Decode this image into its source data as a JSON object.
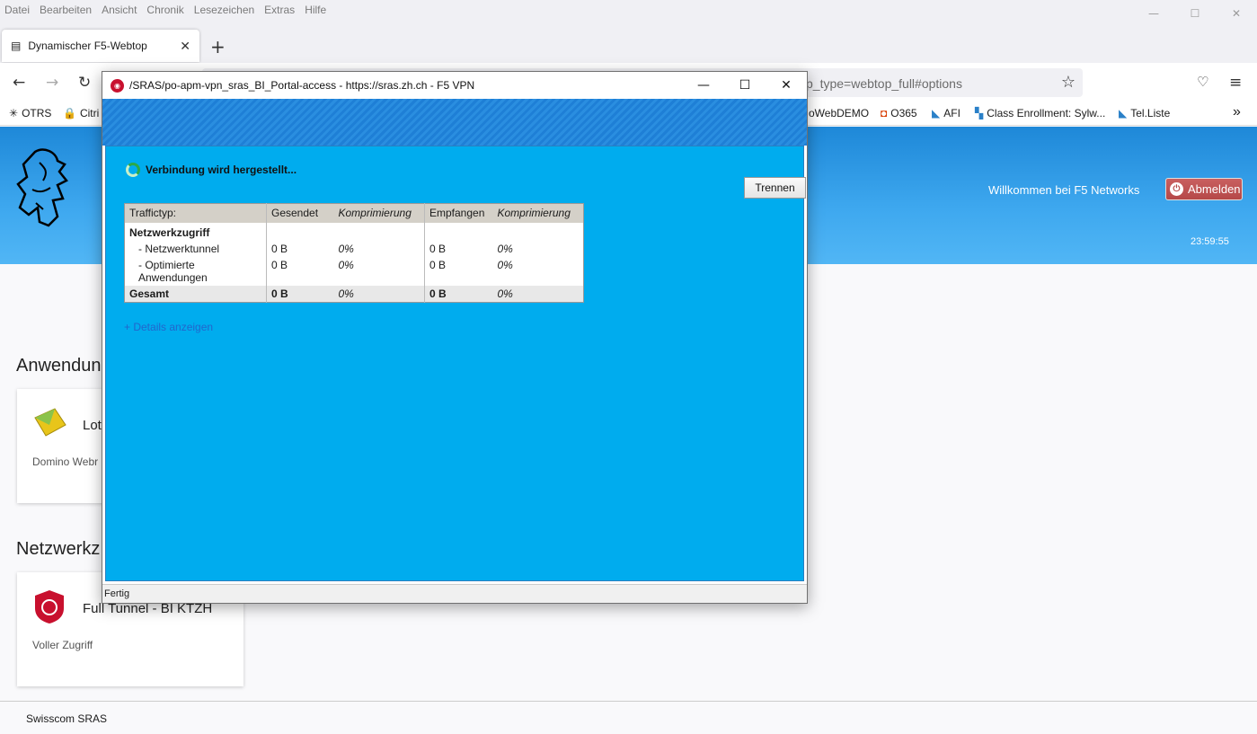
{
  "browser": {
    "menu": [
      "Datei",
      "Bearbeiten",
      "Ansicht",
      "Chronik",
      "Lesezeichen",
      "Extras",
      "Hilfe"
    ],
    "tab_title": "Dynamischer F5-Webtop",
    "url_visible": "p_type=webtop_full#options",
    "bookmarks": [
      "OTRS",
      "Citri",
      "oWebDEMO",
      "O365",
      "AFI",
      "Class Enrollment: Sylw...",
      "Tel.Liste"
    ]
  },
  "webtop": {
    "welcome": "Willkommen bei F5 Networks",
    "logout": "Abmelden",
    "clock": "23:59:55",
    "section_apps": "Anwendun",
    "app_card": {
      "title": "Lot",
      "subtitle": "Domino Webr"
    },
    "section_network": "Netzwerkz",
    "network_card": {
      "title": "Full Tunnel - BI KTZH",
      "subtitle": "Voller Zugriff"
    },
    "footer": "Swisscom SRAS"
  },
  "popup": {
    "title": "/SRAS/po-apm-vpn_sras_BI_Portal-access - https://sras.zh.ch - F5 VPN",
    "status": "Verbindung wird hergestellt...",
    "disconnect": "Trennen",
    "headers": [
      "Traffictyp:",
      "Gesendet",
      "Komprimierung",
      "Empfangen",
      "Komprimierung"
    ],
    "group": "Netzwerkzugriff",
    "rows": [
      {
        "label": "- Netzwerktunnel",
        "sent": "0 B",
        "sent_comp": "0%",
        "recv": "0 B",
        "recv_comp": "0%"
      },
      {
        "label": "- Optimierte",
        "label2": "Anwendungen",
        "sent": "0 B",
        "sent_comp": "0%",
        "recv": "0 B",
        "recv_comp": "0%"
      }
    ],
    "total": {
      "label": "Gesamt",
      "sent": "0 B",
      "sent_comp": "0%",
      "recv": "0 B",
      "recv_comp": "0%"
    },
    "details_link": "+ Details anzeigen",
    "statusbar": "Fertig"
  }
}
